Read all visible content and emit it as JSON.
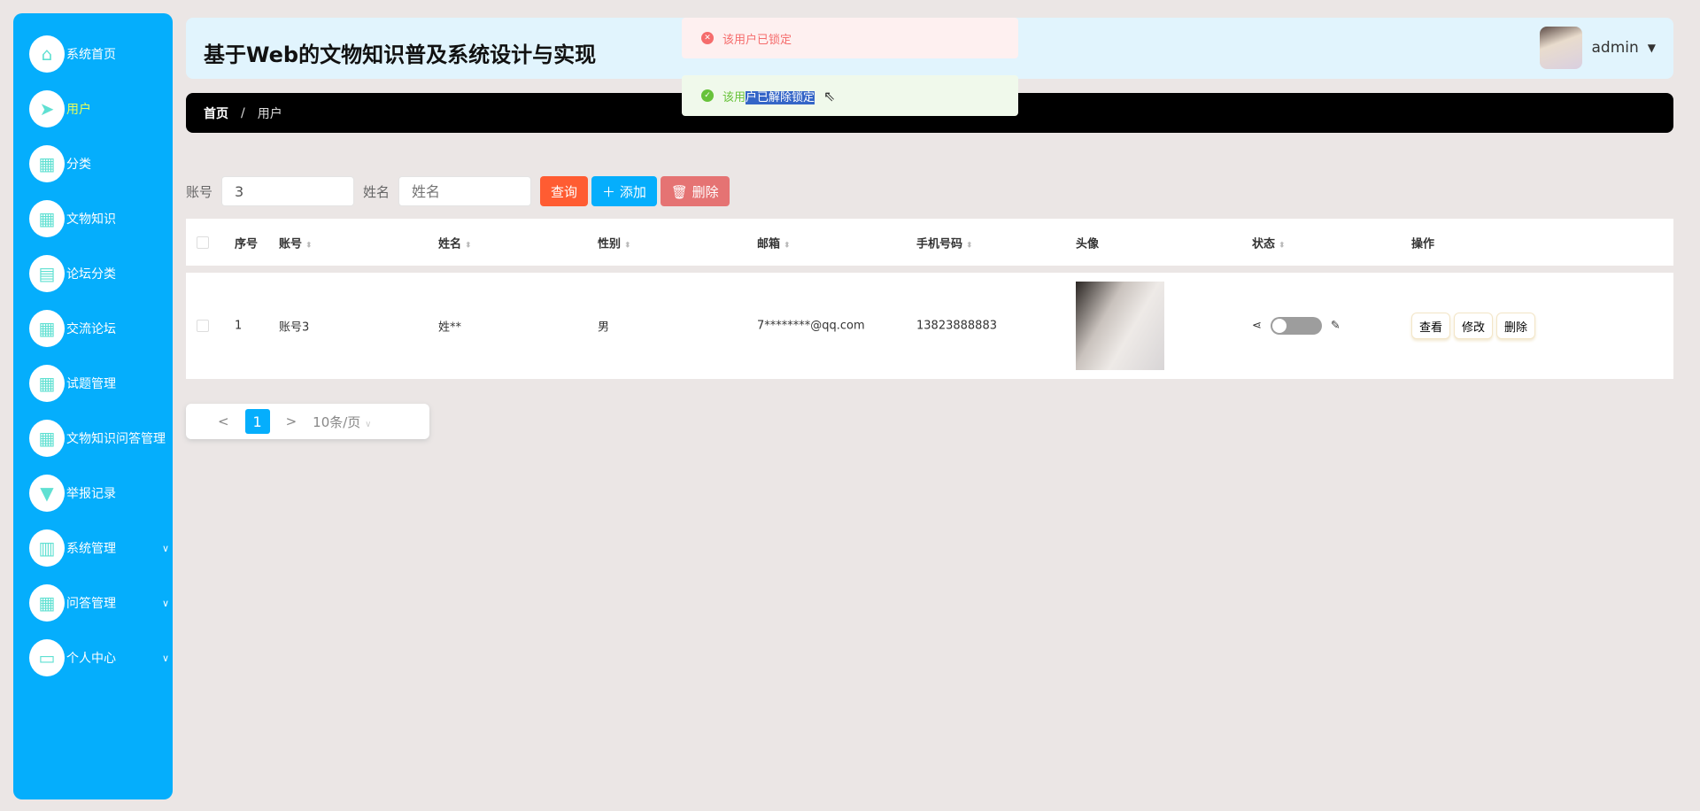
{
  "header": {
    "title": "基于Web的文物知识普及系统设计与实现",
    "user": "admin"
  },
  "sidebar": {
    "items": [
      {
        "label": "系统首页",
        "icon": "home-icon",
        "glyph": "⌂"
      },
      {
        "label": "用户",
        "icon": "send-icon",
        "glyph": "➤",
        "active": true
      },
      {
        "label": "分类",
        "icon": "grid-icon",
        "glyph": "▦"
      },
      {
        "label": "文物知识",
        "icon": "grid-icon",
        "glyph": "▦"
      },
      {
        "label": "论坛分类",
        "icon": "clipboard-icon",
        "glyph": "▤"
      },
      {
        "label": "交流论坛",
        "icon": "apps-icon",
        "glyph": "▦"
      },
      {
        "label": "试题管理",
        "icon": "grid-icon",
        "glyph": "▦"
      },
      {
        "label": "文物知识问答管理",
        "icon": "grid-icon",
        "glyph": "▦"
      },
      {
        "label": "举报记录",
        "icon": "brush-icon",
        "glyph": "▼"
      },
      {
        "label": "系统管理",
        "icon": "book-icon",
        "glyph": "▥",
        "chevron": true
      },
      {
        "label": "问答管理",
        "icon": "grid-icon",
        "glyph": "▦",
        "chevron": true
      },
      {
        "label": "个人中心",
        "icon": "card-icon",
        "glyph": "▭",
        "chevron": true
      }
    ]
  },
  "breadcrumb": {
    "home": "首页",
    "sep": "/",
    "current": "用户"
  },
  "toasts": {
    "error": "该用户已锁定",
    "success_a": "该用",
    "success_b": "户已解除锁定"
  },
  "search": {
    "account_label": "账号",
    "account_value": "3",
    "name_label": "姓名",
    "name_placeholder": "姓名",
    "query": "查询",
    "add": "添加",
    "delete": "删除"
  },
  "table": {
    "headers": [
      "序号",
      "账号",
      "姓名",
      "性别",
      "邮箱",
      "手机号码",
      "头像",
      "状态",
      "操作"
    ],
    "rows": [
      {
        "index": "1",
        "account": "账号3",
        "name": "姓**",
        "gender": "男",
        "email": "7********@qq.com",
        "phone": "13823888883",
        "locked": false
      }
    ],
    "actions": [
      "查看",
      "修改",
      "删除"
    ]
  },
  "pagination": {
    "prev": "<",
    "page": "1",
    "next": ">",
    "size": "10条/页"
  },
  "colors": {
    "sidebar": "#05aefc",
    "query": "#ff5c32",
    "add": "#05aefc",
    "delete": "#e57373"
  }
}
